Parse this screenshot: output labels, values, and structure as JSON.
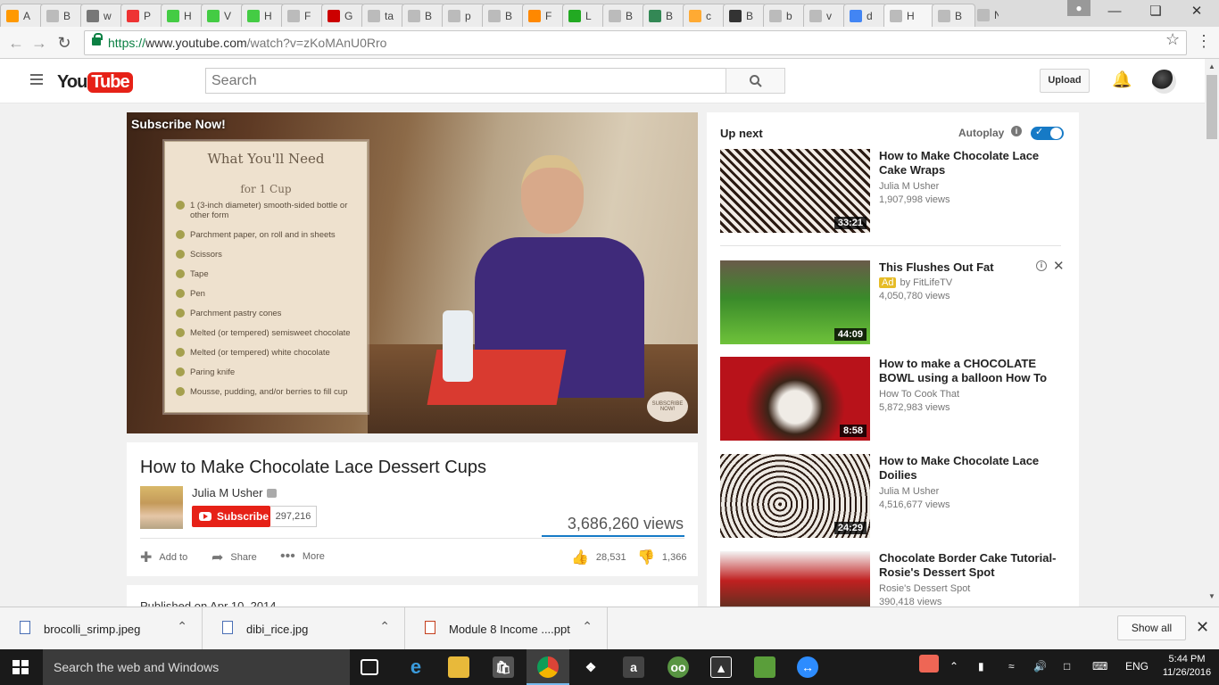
{
  "browser": {
    "tabs": [
      {
        "label": "A",
        "color": "#f90"
      },
      {
        "label": "B",
        "color": "#bbb"
      },
      {
        "label": "w",
        "color": "#777"
      },
      {
        "label": "P",
        "color": "#e33"
      },
      {
        "label": "H",
        "color": "#4c4"
      },
      {
        "label": "V",
        "color": "#4c4"
      },
      {
        "label": "H",
        "color": "#4c4"
      },
      {
        "label": "F",
        "color": "#bbb"
      },
      {
        "label": "G",
        "color": "#c00"
      },
      {
        "label": "ta",
        "color": "#bbb"
      },
      {
        "label": "B",
        "color": "#bbb"
      },
      {
        "label": "p",
        "color": "#bbb"
      },
      {
        "label": "B",
        "color": "#bbb"
      },
      {
        "label": "F",
        "color": "#f80"
      },
      {
        "label": "L",
        "color": "#2a2"
      },
      {
        "label": "B",
        "color": "#bbb"
      },
      {
        "label": "B",
        "color": "#385"
      },
      {
        "label": "c",
        "color": "#fa3"
      },
      {
        "label": "B",
        "color": "#333"
      },
      {
        "label": "b",
        "color": "#bbb"
      },
      {
        "label": "v",
        "color": "#bbb"
      },
      {
        "label": "d",
        "color": "#4285f4"
      },
      {
        "label": "H",
        "color": "#bbb"
      },
      {
        "label": "B",
        "color": "#bbb"
      },
      {
        "label": "New",
        "color": "#bbb"
      }
    ],
    "url_scheme": "https://",
    "url_host": "www.youtube.com",
    "url_path": "/watch?v=zKoMAnU0Rro"
  },
  "youtube": {
    "logo_you": "You",
    "logo_tube": "Tube",
    "search_placeholder": "Search",
    "upload_label": "Upload"
  },
  "player": {
    "overlay_text": "Subscribe Now!",
    "card_title": "What You'll Need",
    "card_subtitle": "for 1 Cup",
    "card_items": [
      "1 (3-inch diameter) smooth-sided bottle or other form",
      "Parchment paper, on roll and in sheets",
      "Scissors",
      "Tape",
      "Pen",
      "Parchment pastry cones",
      "Melted (or tempered) semisweet chocolate",
      "Melted (or tempered) white chocolate",
      "Paring knife",
      "Mousse, pudding, and/or berries to fill cup"
    ],
    "badge_text": "SUBSCRIBE NOW!"
  },
  "video": {
    "title": "How to Make Chocolate Lace Dessert Cups",
    "channel": "Julia M Usher",
    "subscribe_label": "Subscribe",
    "subscriber_count": "297,216",
    "views": "3,686,260 views",
    "add_to": "Add to",
    "share": "Share",
    "more": "More",
    "likes": "28,531",
    "dislikes": "1,366",
    "published": "Published on Apr 10, 2014"
  },
  "sidebar": {
    "up_next": "Up next",
    "autoplay": "Autoplay",
    "autoplay_on": true,
    "items": [
      {
        "title": "How to Make Chocolate Lace Cake Wraps",
        "channel": "Julia M Usher",
        "views": "1,907,998 views",
        "duration": "33:21",
        "ad": false
      },
      {
        "title": "This Flushes Out Fat",
        "channel": "by FitLifeTV",
        "views": "4,050,780 views",
        "duration": "44:09",
        "ad": true,
        "ad_label": "Ad"
      },
      {
        "title": "How to make a CHOCOLATE BOWL using a balloon How To",
        "channel": "How To Cook That",
        "views": "5,872,983 views",
        "duration": "8:58",
        "ad": false
      },
      {
        "title": "How to Make Chocolate Lace Doilies",
        "channel": "Julia M Usher",
        "views": "4,516,677 views",
        "duration": "24:29",
        "ad": false
      },
      {
        "title": "Chocolate Border Cake Tutorial- Rosie's Dessert Spot",
        "channel": "Rosie's Dessert Spot",
        "views": "390,418 views",
        "duration": "",
        "ad": false
      }
    ]
  },
  "downloads": {
    "items": [
      {
        "name": "brocolli_srimp.jpeg",
        "type": "image"
      },
      {
        "name": "dibi_rice.jpg",
        "type": "image"
      },
      {
        "name": "Module 8 Income ....ppt",
        "type": "ppt"
      }
    ],
    "show_all": "Show all"
  },
  "taskbar": {
    "search_placeholder": "Search the web and Windows",
    "language": "ENG",
    "time": "5:44 PM",
    "date": "11/26/2016"
  }
}
